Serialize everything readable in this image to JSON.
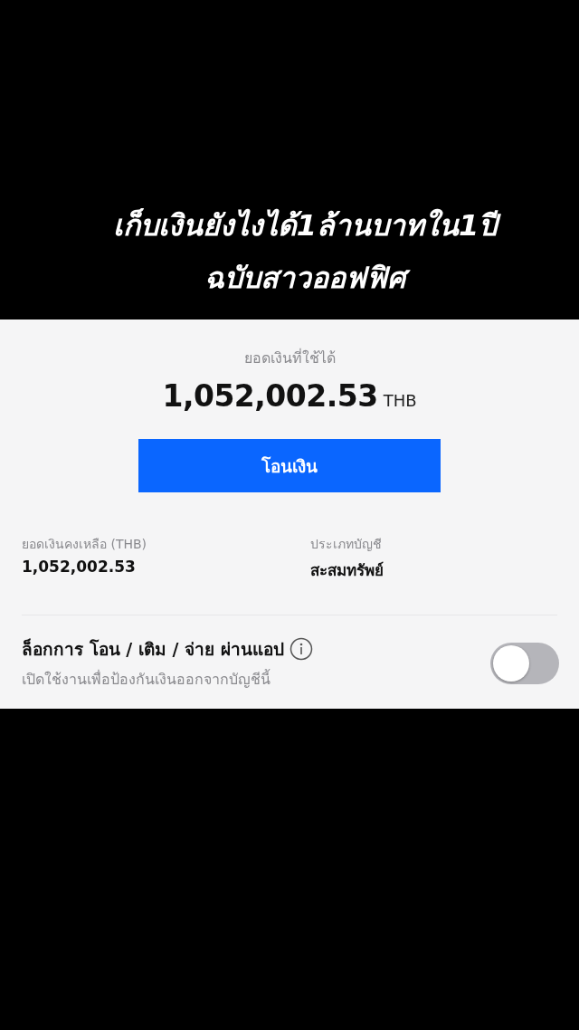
{
  "caption": {
    "lines": [
      "เก็บเงินยังไงได้1ล้านบาทใน1ปี",
      "ฉบับสาวออฟฟิศ"
    ]
  },
  "balance": {
    "label": "ยอดเงินที่ใช้ได้",
    "amount": "1,052,002.53",
    "currency": "THB"
  },
  "transfer_button": {
    "label": "โอนเงิน"
  },
  "details": [
    {
      "label": "ยอดเงินคงเหลือ (THB)",
      "value": "1,052,002.53"
    },
    {
      "label": "ประเภทบัญชี",
      "value": "สะสมทรัพย์"
    }
  ],
  "lock_setting": {
    "title": "ล็อกการ โอน / เติม / จ่าย ผ่านแอป",
    "description": "เปิดใช้งานเพื่อป้องกันเงินออกจากบัญชีนี้",
    "on": false
  }
}
